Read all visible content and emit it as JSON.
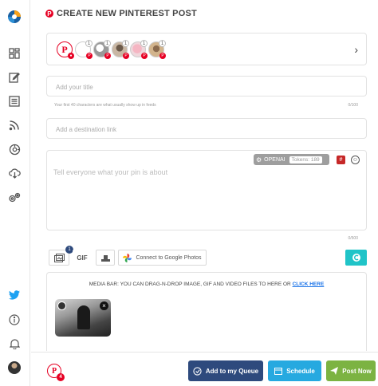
{
  "page": {
    "title": "CREATE NEW PINTEREST POST"
  },
  "sidebar": {
    "items": [
      {
        "icon": "app-logo-icon"
      },
      {
        "icon": "dashboard-icon"
      },
      {
        "icon": "compose-icon"
      },
      {
        "icon": "posts-icon"
      },
      {
        "icon": "rss-icon"
      },
      {
        "icon": "automation-icon"
      },
      {
        "icon": "cloud-download-icon"
      },
      {
        "icon": "settings-icon"
      },
      {
        "icon": "twitter-icon"
      },
      {
        "icon": "info-icon"
      },
      {
        "icon": "bell-icon"
      },
      {
        "icon": "user-avatar-icon"
      }
    ]
  },
  "accounts": [
    {
      "count": "",
      "selected": true
    },
    {
      "count": "1"
    },
    {
      "count": "1"
    },
    {
      "count": "1"
    },
    {
      "count": "1"
    },
    {
      "count": "1"
    }
  ],
  "form": {
    "title_placeholder": "Add your title",
    "title_hint": "Your first 40 characters are what usually show up in feeds",
    "title_count": "0/100",
    "link_placeholder": "Add a destination link",
    "description_placeholder": "Tell everyone what your pin is about",
    "description_count": "0/500",
    "openai_label": "OPENAI",
    "tokens_label": "Tokens: 189"
  },
  "toolbar": {
    "media_badge": "1",
    "gif_label": "GIF",
    "google_photos_label": "Connect to Google Photos"
  },
  "media": {
    "drop_text": "MEDIA BAR: YOU CAN DRAG-N-DROP IMAGE, GIF AND VIDEO FILES TO HERE OR",
    "click_here": "CLICK HERE"
  },
  "footer": {
    "selected_count": "4",
    "queue_label": "Add to my Queue",
    "schedule_label": "Schedule",
    "post_label": "Post Now"
  },
  "colors": {
    "pinterest_red": "#e60023",
    "queue_button": "#2e4a7d",
    "schedule_button": "#26a9e0",
    "post_button": "#7cb342",
    "teal": "#20c4c8"
  }
}
